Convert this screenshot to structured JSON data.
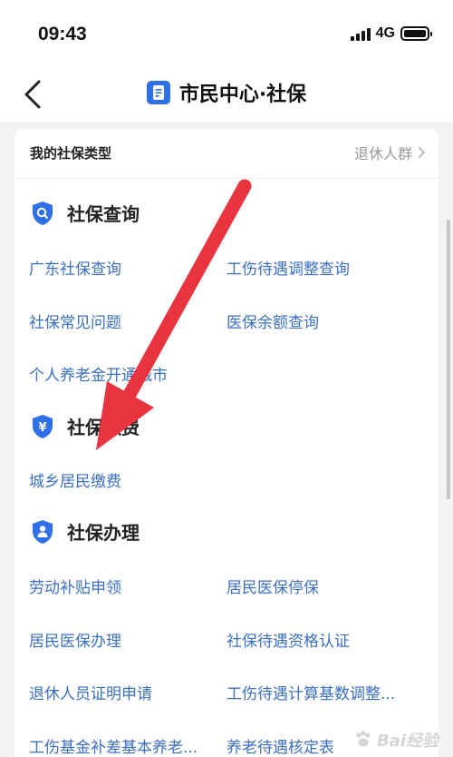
{
  "status_bar": {
    "time": "09:43",
    "network": "4G"
  },
  "nav": {
    "title": "市民中心·社保",
    "icons": {
      "back": "chevron-left-icon",
      "doc": "document-icon"
    }
  },
  "type_row": {
    "label": "我的社保类型",
    "value": "退休人群"
  },
  "sections": [
    {
      "title": "社保查询",
      "icon": "search-shield-icon",
      "items": [
        "广东社保查询",
        "工伤待遇调整查询",
        "社保常见问题",
        "医保余额查询",
        "个人养老金开通城市"
      ]
    },
    {
      "title": "社保缴费",
      "icon": "yen-shield-icon",
      "items": [
        "城乡居民缴费"
      ]
    },
    {
      "title": "社保办理",
      "icon": "person-shield-icon",
      "items": [
        "劳动补贴申领",
        "居民医保停保",
        "居民医保办理",
        "社保待遇资格认证",
        "退休人员证明申请",
        "工伤待遇计算基数调整...",
        "工伤基金补差基本养老...",
        "养老待遇核定表"
      ]
    }
  ],
  "colors": {
    "accent": "#2f6fe8",
    "link": "#3b6fc4",
    "arrow": "#e8343f"
  },
  "watermark": {
    "text": "Bai经验"
  }
}
